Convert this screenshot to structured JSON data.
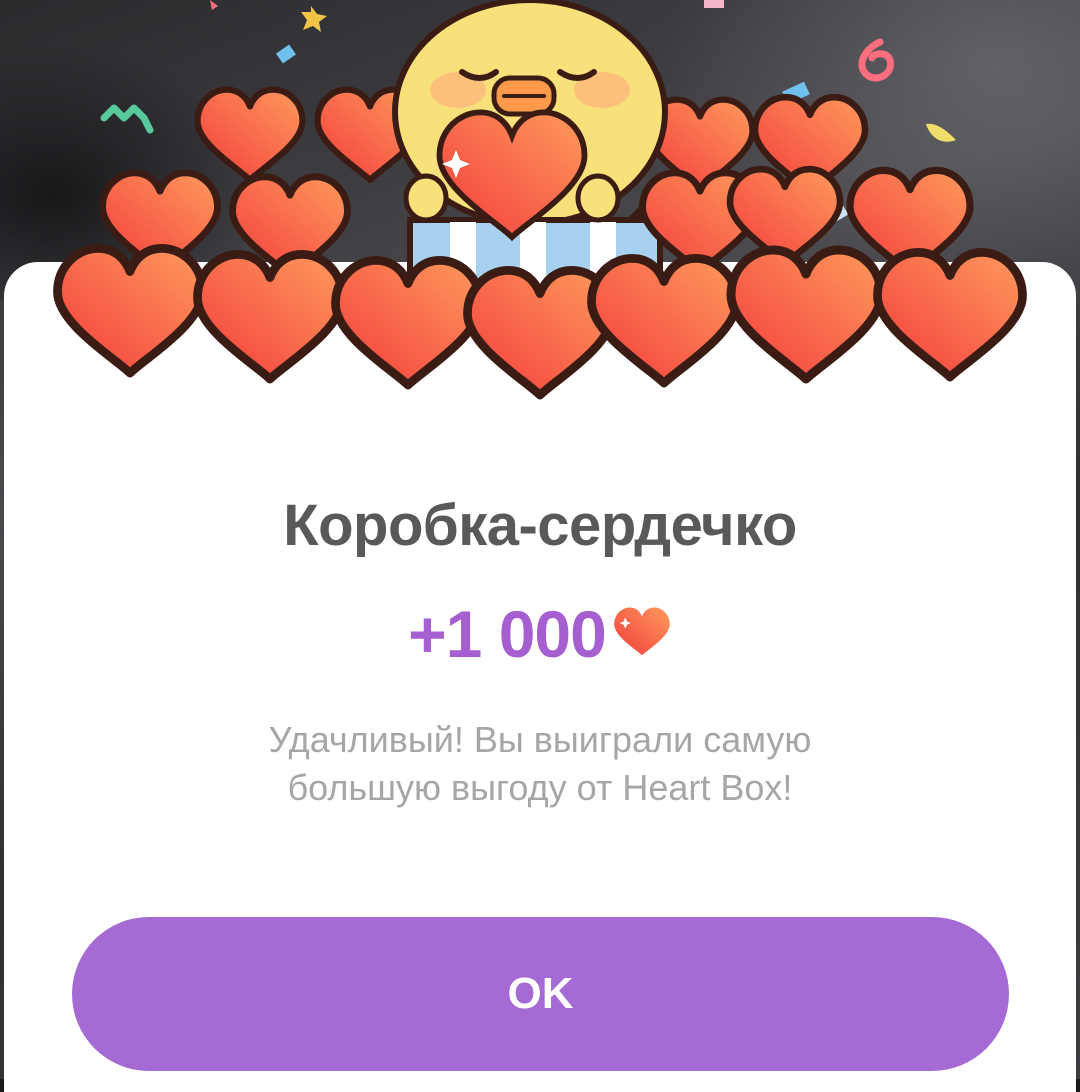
{
  "dialog": {
    "title": "Коробка-сердечко",
    "reward_amount": "+1 000",
    "reward_icon": "heart-icon",
    "message": "Удачливый! Вы выиграли самую большую выгоду от Heart Box!",
    "ok_label": "OK"
  },
  "colors": {
    "accent": "#a56ad3",
    "reward_text": "#a55fd0",
    "title_text": "#595959",
    "message_text": "#a6a6a6",
    "heart_top": "#ff8f5a",
    "heart_bottom": "#f23c3c",
    "duck": "#f8e07a"
  }
}
